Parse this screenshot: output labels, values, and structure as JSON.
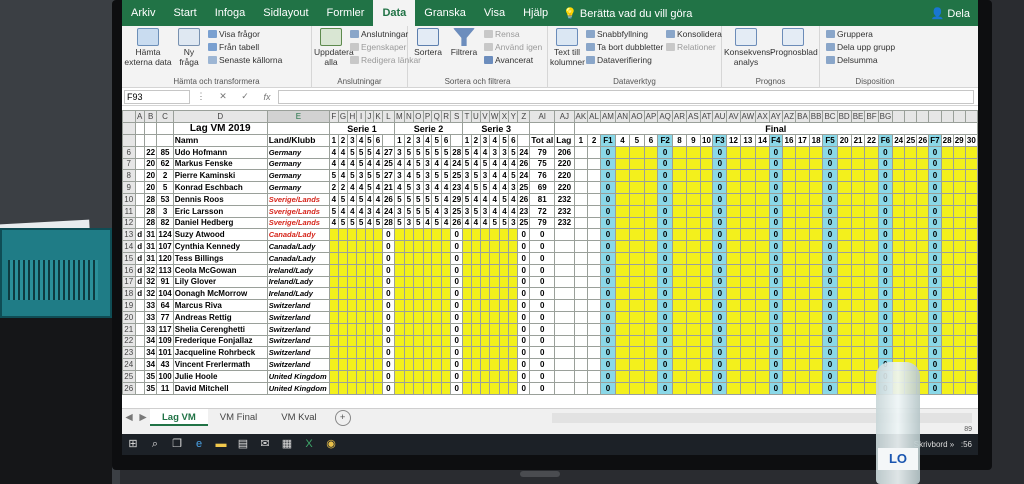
{
  "menu": {
    "tabs": [
      "Arkiv",
      "Start",
      "Infoga",
      "Sidlayout",
      "Formler",
      "Data",
      "Granska",
      "Visa",
      "Hjälp"
    ],
    "active_tab": "Data",
    "tell_me": "Berätta vad du vill göra",
    "share": "Dela"
  },
  "ribbon": {
    "get_external": "Hämta externa data",
    "new_query": "Ny fråga",
    "show_queries": "Visa frågor",
    "from_table": "Från tabell",
    "recent_sources": "Senaste källorna",
    "group1_label": "Hämta och transformera",
    "refresh_all": "Uppdatera alla",
    "connections": "Anslutningar",
    "properties": "Egenskaper",
    "edit_links": "Redigera länkar",
    "group2_label": "Anslutningar",
    "sort": "Sortera",
    "filter": "Filtrera",
    "clear": "Rensa",
    "reapply": "Använd igen",
    "advanced": "Avancerat",
    "group3_label": "Sortera och filtrera",
    "text_to_columns": "Text till kolumner",
    "flash_fill": "Snabbfyllning",
    "remove_duplicates": "Ta bort dubbletter",
    "data_validation": "Dataverifiering",
    "consolidate": "Konsolidera",
    "relations": "Relationer",
    "group4_label": "Dataverktyg",
    "what_if": "Konsekvens-analys",
    "forecast_sheet": "Prognosblad",
    "group5_label": "Prognos",
    "group_btn": "Gruppera",
    "ungroup_btn": "Dela upp grupp",
    "subtotal_btn": "Delsumma",
    "group6_label": "Disposition"
  },
  "formula_bar": {
    "name_box": "F93",
    "fx": "fx"
  },
  "sheet": {
    "col_letters": [
      "A",
      "B",
      "C",
      "D",
      "E",
      "F",
      "G",
      "H",
      "I",
      "J",
      "K",
      "L",
      "M",
      "N",
      "O",
      "P",
      "Q",
      "R",
      "S",
      "T",
      "U",
      "V",
      "W",
      "X",
      "Y",
      "Z",
      "AI",
      "AJ",
      "AK",
      "AL",
      "AM",
      "AN",
      "AO",
      "AP",
      "AQ",
      "AR",
      "AS",
      "AT",
      "AU",
      "AV",
      "AW",
      "AX",
      "AY",
      "AZ",
      "BA",
      "BB",
      "BC",
      "BD",
      "BE",
      "BF",
      "BG"
    ],
    "title": "Lag VM 2019",
    "serie1": "Serie 1",
    "serie2": "Serie 2",
    "serie3": "Serie 3",
    "final": "Final",
    "name_header": "Namn",
    "country_header": "Land/Klubb",
    "total_header": "Tot al",
    "lag_header": "Lag",
    "rows": [
      {
        "row": "6",
        "g": "",
        "a": "22",
        "nr": "85",
        "name": "Udo Hofmann",
        "country": "Germany",
        "red": false,
        "s1": [
          "4",
          "4",
          "5",
          "5",
          "5",
          "4"
        ],
        "s1t": "27",
        "s2": [
          "3",
          "5",
          "5",
          "5",
          "5",
          "5"
        ],
        "s2t": "28",
        "s3": [
          "5",
          "4",
          "4",
          "3",
          "3",
          "5"
        ],
        "s3t": "24",
        "tot": "79",
        "lag": "206"
      },
      {
        "row": "7",
        "g": "",
        "a": "20",
        "nr": "62",
        "name": "Markus Fenske",
        "country": "Germany",
        "red": false,
        "s1": [
          "4",
          "4",
          "4",
          "5",
          "4",
          "4"
        ],
        "s1t": "25",
        "s2": [
          "4",
          "4",
          "5",
          "3",
          "4",
          "4"
        ],
        "s2t": "24",
        "s3": [
          "5",
          "4",
          "5",
          "4",
          "4",
          "4"
        ],
        "s3t": "26",
        "tot": "75",
        "lag": "220"
      },
      {
        "row": "8",
        "g": "",
        "a": "20",
        "nr": "2",
        "name": "Pierre Kaminski",
        "country": "Germany",
        "red": false,
        "s1": [
          "5",
          "4",
          "5",
          "3",
          "5",
          "5"
        ],
        "s1t": "27",
        "s2": [
          "3",
          "4",
          "5",
          "3",
          "5",
          "5"
        ],
        "s2t": "25",
        "s3": [
          "3",
          "5",
          "3",
          "4",
          "4",
          "5"
        ],
        "s3t": "24",
        "tot": "76",
        "lag": "220"
      },
      {
        "row": "9",
        "g": "",
        "a": "20",
        "nr": "5",
        "name": "Konrad Eschbach",
        "country": "Germany",
        "red": false,
        "s1": [
          "2",
          "2",
          "4",
          "4",
          "5",
          "4"
        ],
        "s1t": "21",
        "s2": [
          "4",
          "5",
          "3",
          "3",
          "4",
          "4"
        ],
        "s2t": "23",
        "s3": [
          "4",
          "5",
          "5",
          "4",
          "4",
          "3"
        ],
        "s3t": "25",
        "tot": "69",
        "lag": "220"
      },
      {
        "row": "10",
        "g": "",
        "a": "28",
        "nr": "53",
        "name": "Dennis Roos",
        "country": "Sverige/Lands",
        "red": true,
        "s1": [
          "4",
          "5",
          "4",
          "5",
          "4",
          "4"
        ],
        "s1t": "26",
        "s2": [
          "5",
          "5",
          "5",
          "5",
          "5",
          "4"
        ],
        "s2t": "29",
        "s3": [
          "5",
          "4",
          "4",
          "4",
          "5",
          "4"
        ],
        "s3t": "26",
        "tot": "81",
        "lag": "232"
      },
      {
        "row": "11",
        "g": "",
        "a": "28",
        "nr": "3",
        "name": "Eric Larsson",
        "country": "Sverige/Lands",
        "red": true,
        "s1": [
          "5",
          "4",
          "4",
          "4",
          "3",
          "4"
        ],
        "s1t": "24",
        "s2": [
          "3",
          "5",
          "5",
          "5",
          "4",
          "3"
        ],
        "s2t": "25",
        "s3": [
          "3",
          "5",
          "3",
          "4",
          "4",
          "4"
        ],
        "s3t": "23",
        "tot": "72",
        "lag": "232"
      },
      {
        "row": "12",
        "g": "",
        "a": "28",
        "nr": "82",
        "name": "Daniel Hedberg",
        "country": "Sverige/Lands",
        "red": true,
        "s1": [
          "4",
          "5",
          "5",
          "5",
          "4",
          "5"
        ],
        "s1t": "28",
        "s2": [
          "5",
          "3",
          "5",
          "4",
          "5",
          "4"
        ],
        "s2t": "26",
        "s3": [
          "4",
          "4",
          "4",
          "5",
          "5",
          "3"
        ],
        "s3t": "25",
        "tot": "79",
        "lag": "232"
      },
      {
        "row": "13",
        "g": "d",
        "a": "31",
        "nr": "124",
        "name": "Suzy Atwood",
        "country": "Canada/Lady",
        "red": true
      },
      {
        "row": "14",
        "g": "d",
        "a": "31",
        "nr": "107",
        "name": "Cynthia Kennedy",
        "country": "Canada/Lady",
        "red": false
      },
      {
        "row": "15",
        "g": "d",
        "a": "31",
        "nr": "120",
        "name": "Tess Billings",
        "country": "Canada/Lady",
        "red": false
      },
      {
        "row": "16",
        "g": "d",
        "a": "32",
        "nr": "113",
        "name": "Ceola McGowan",
        "country": "Ireland/Lady",
        "red": false
      },
      {
        "row": "17",
        "g": "d",
        "a": "32",
        "nr": "91",
        "name": "Lily Glover",
        "country": "Ireland/Lady",
        "red": false
      },
      {
        "row": "18",
        "g": "d",
        "a": "32",
        "nr": "104",
        "name": "Oonagh McMorrow",
        "country": "Ireland/Lady",
        "red": false
      },
      {
        "row": "19",
        "g": "",
        "a": "33",
        "nr": "64",
        "name": "Marcus Riva",
        "country": "Switzerland",
        "red": false
      },
      {
        "row": "20",
        "g": "",
        "a": "33",
        "nr": "77",
        "name": "Andreas Rettig",
        "country": "Switzerland",
        "red": false
      },
      {
        "row": "21",
        "g": "",
        "a": "33",
        "nr": "117",
        "name": "Shelia Cerenghetti",
        "country": "Switzerland",
        "red": false
      },
      {
        "row": "22",
        "g": "",
        "a": "34",
        "nr": "109",
        "name": "Frederique Fonjallaz",
        "country": "Switzerland",
        "red": false
      },
      {
        "row": "23",
        "g": "",
        "a": "34",
        "nr": "101",
        "name": "Jacqueline Rohrbeck",
        "country": "Switzerland",
        "red": false
      },
      {
        "row": "24",
        "g": "",
        "a": "34",
        "nr": "43",
        "name": "Vincent Frerlermath",
        "country": "Switzerland",
        "red": false
      },
      {
        "row": "25",
        "g": "",
        "a": "35",
        "nr": "100",
        "name": "Julie Hoole",
        "country": "United Kingdom",
        "red": false
      },
      {
        "row": "26",
        "g": "",
        "a": "35",
        "nr": "11",
        "name": "David Mitchell",
        "country": "United Kingdom",
        "red": false
      }
    ]
  },
  "sheet_tabs": [
    "Lag VM",
    "VM Final",
    "VM Kval"
  ],
  "active_sheet": "Lag VM",
  "status": {
    "zoom": "89"
  },
  "taskbar": {
    "desktop_label": "Skrivbord",
    "clock": ":56"
  },
  "bottle_label": "LO",
  "colors": {
    "excel_green": "#217346",
    "yellow_fill": "#f3f01c",
    "cyan_fill": "#8ad8e8",
    "red_text": "#d6261c"
  }
}
